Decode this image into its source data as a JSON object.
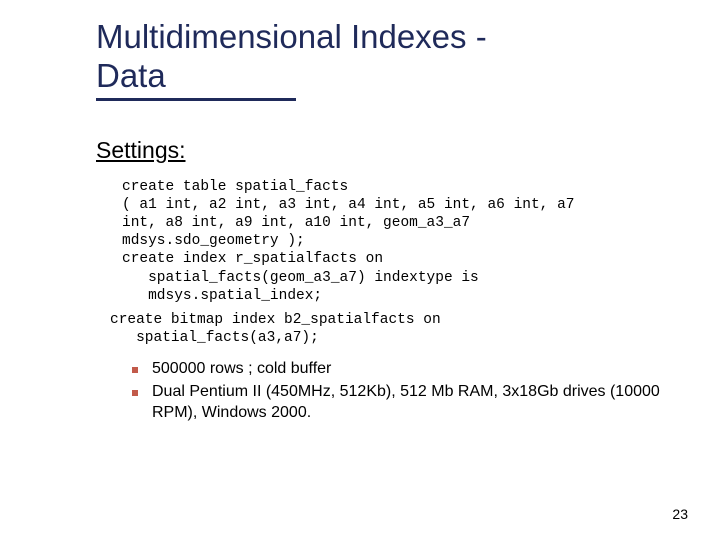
{
  "title_line1": "Multidimensional Indexes -",
  "title_line2": "Data",
  "subheading": "Settings:",
  "code1": "create table spatial_facts\n( a1 int, a2 int, a3 int, a4 int, a5 int, a6 int, a7\nint, a8 int, a9 int, a10 int, geom_a3_a7\nmdsys.sdo_geometry );\ncreate index r_spatialfacts on\n   spatial_facts(geom_a3_a7) indextype is\n   mdsys.spatial_index;",
  "code2": "create bitmap index b2_spatialfacts on\n   spatial_facts(a3,a7);",
  "bullets": [
    "500000 rows ; cold buffer",
    "Dual Pentium II (450MHz, 512Kb), 512 Mb RAM, 3x18Gb drives (10000 RPM), Windows 2000."
  ],
  "page_number": "23"
}
